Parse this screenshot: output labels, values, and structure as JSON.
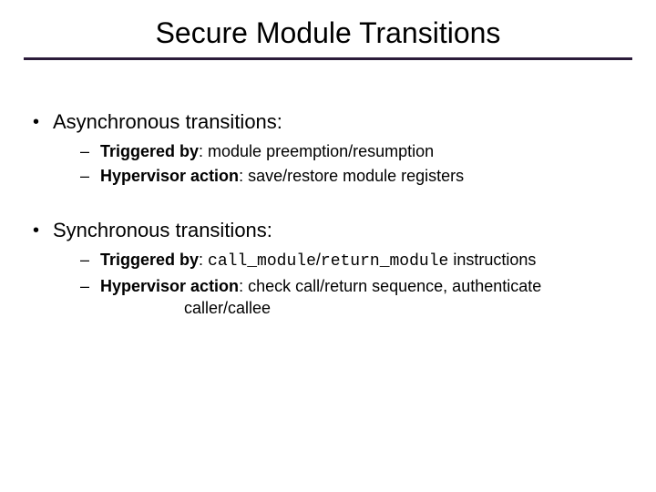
{
  "title": "Secure Module Transitions",
  "sections": [
    {
      "heading": "Asynchronous transitions:",
      "items": [
        {
          "label": "Triggered by",
          "rest": ": module preemption/resumption"
        },
        {
          "label": "Hypervisor action",
          "rest": ": save/restore module registers"
        }
      ]
    },
    {
      "heading": "Synchronous transitions:",
      "items": [
        {
          "label": "Triggered by",
          "rest_prefix": ": ",
          "code1": "call_module",
          "sep": "/",
          "code2": "return_module",
          "rest_suffix": " instructions"
        },
        {
          "label": "Hypervisor action",
          "rest": ": check call/return sequence, authenticate",
          "cont": "caller/callee"
        }
      ]
    }
  ]
}
